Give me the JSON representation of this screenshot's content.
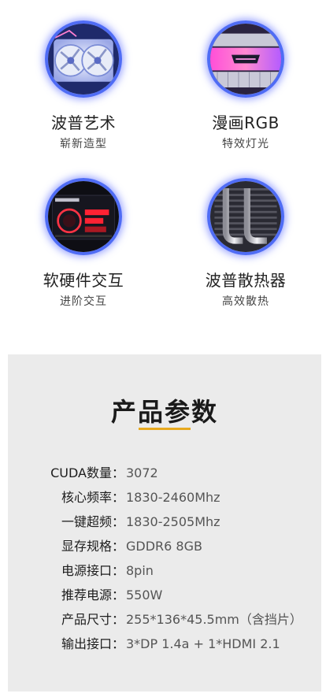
{
  "features": [
    {
      "title": "波普艺术",
      "subtitle": "崭新造型",
      "image": "white-graphics-card-fans"
    },
    {
      "title": "漫画RGB",
      "subtitle": "特效灯光",
      "image": "rgb-light-bar-with-logo"
    },
    {
      "title": "软硬件交互",
      "subtitle": "进阶交互",
      "image": "software-dashboard-screen"
    },
    {
      "title": "波普散热器",
      "subtitle": "高效散热",
      "image": "heatsink-heatpipes"
    }
  ],
  "specs": {
    "heading": "产品参数",
    "accent_color": "#e7a91f",
    "rows": [
      {
        "label": "CUDA数量：",
        "value": "3072"
      },
      {
        "label": "核心频率：",
        "value": "1830-2460Mhz"
      },
      {
        "label": "一键超频：",
        "value": "1830-2505Mhz"
      },
      {
        "label": "显存规格：",
        "value": "GDDR6 8GB"
      },
      {
        "label": "电源接口：",
        "value": "8pin"
      },
      {
        "label": "推荐电源：",
        "value": "550W"
      },
      {
        "label": "产品尺寸：",
        "value": "255*136*45.5mm（含挡片）"
      },
      {
        "label": "输出接口：",
        "value": "3*DP 1.4a + 1*HDMI 2.1"
      }
    ]
  }
}
